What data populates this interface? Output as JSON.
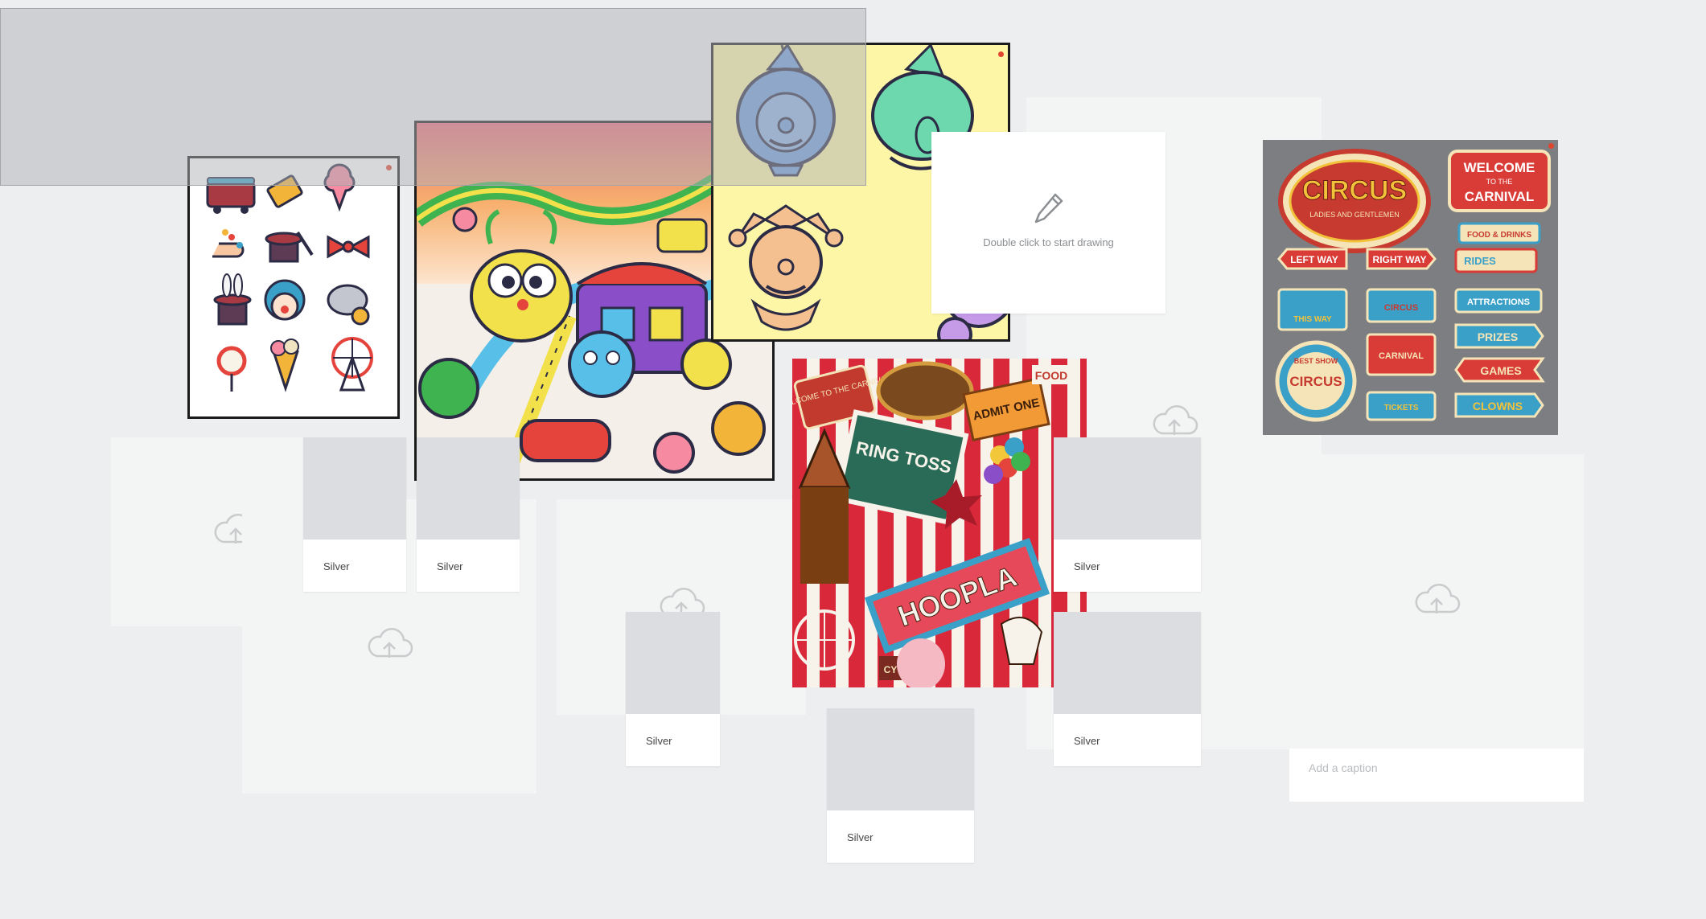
{
  "board": {
    "background": "#eceef0",
    "accent_dot_color": "#e0452d"
  },
  "drawing_card": {
    "hint": "Double click to start drawing",
    "icon": "pencil-icon"
  },
  "caption_card": {
    "placeholder": "Add a caption",
    "icon": "upload-cloud-icon"
  },
  "swatches": [
    {
      "name": "Silver",
      "color": "#dcdde0"
    },
    {
      "name": "Silver",
      "color": "#dcdde0"
    },
    {
      "name": "Silver",
      "color": "#dcdde0"
    },
    {
      "name": "Silver",
      "color": "#dcdde0"
    },
    {
      "name": "Silver",
      "color": "#dcdde0"
    },
    {
      "name": "Silver",
      "color": "#dcdde0"
    }
  ],
  "images": {
    "icons_sheet": "circus icon grid",
    "cartoon_carnival": "carnival cartoon illustration",
    "clown_heads": "clown heads illustration",
    "collage": "carnival collage",
    "signs": "circus signs sheet"
  },
  "collage_text": {
    "welcome": "WELCOME TO THE CARNIVAL",
    "admit": "ADMIT ONE",
    "food": "FOOD",
    "ring_toss": "RING TOSS",
    "hoopla": "HOOPLA",
    "cyclone": "CYCLONE"
  },
  "signs_text": {
    "circus": "CIRCUS",
    "circus_sub": "LADIES AND GENTLEMEN",
    "welcome_top": "WELCOME",
    "welcome_mid": "TO THE",
    "welcome_bottom": "CARNIVAL",
    "food_drinks": "FOOD & DRINKS",
    "left_way": "LEFT WAY",
    "right_way": "RIGHT WAY",
    "rides": "RIDES",
    "this_way": "THIS WAY",
    "circus_small": "CIRCUS",
    "attractions": "ATTRACTIONS",
    "best_show": "BEST SHOW",
    "circus_round": "CIRCUS",
    "carnival_small": "CARNIVAL",
    "prizes": "PRIZES",
    "games": "GAMES",
    "tickets": "TICKETS",
    "clowns": "CLOWNS"
  }
}
